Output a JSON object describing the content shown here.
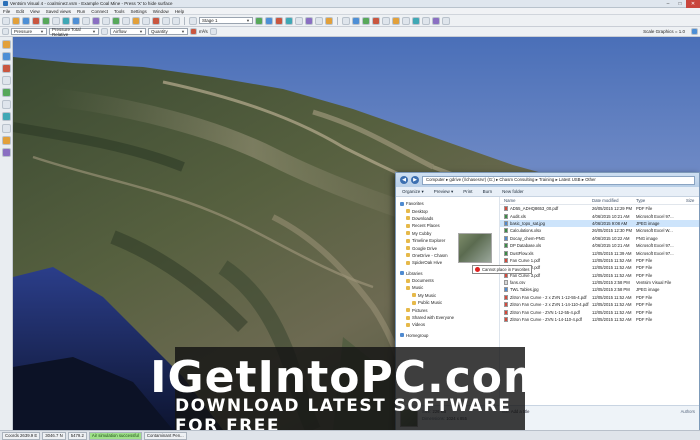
{
  "window": {
    "title": "Ventsim Visual 4 - coalmine2.vsm - Example Coal Mine - Press 'X' to hide surface",
    "buttons": {
      "minimize": "–",
      "maximize": "□",
      "close": "✕"
    }
  },
  "menu": [
    "File",
    "Edit",
    "View",
    "Saved views",
    "Run",
    "Connect",
    "Tools",
    "Settings",
    "Window",
    "Help"
  ],
  "toolbar": {
    "stage_combo": "Stage 1",
    "pressure_combo": "Pressure",
    "pressure_total_combo": "Pressure Total Relative",
    "airflow_combo": "Airflow",
    "quantity_combo": "Quantity",
    "units_label": "m³/s",
    "scale_text": "Scale Graphics = 1.0"
  },
  "explorer": {
    "path": "Computer ▸ gdrive (\\\\chasesrvr) (G:) ▸ Chasm Consulting ▸ Training ▸ Latest USB ▸ Other",
    "commands": [
      "Organize ▾",
      "Preview ▾",
      "Print",
      "Burn",
      "New folder"
    ],
    "nav": [
      {
        "label": "Favorites",
        "level": 0,
        "icon": "star-icon"
      },
      {
        "label": "Desktop",
        "level": 1,
        "icon": "folder-icon"
      },
      {
        "label": "Downloads",
        "level": 1,
        "icon": "folder-icon"
      },
      {
        "label": "Recent Places",
        "level": 1,
        "icon": "folder-icon"
      },
      {
        "label": "My Cubby",
        "level": 1,
        "icon": "folder-icon"
      },
      {
        "label": "Timeline Explorer",
        "level": 1,
        "icon": "folder-icon"
      },
      {
        "label": "Google Drive",
        "level": 1,
        "icon": "folder-icon"
      },
      {
        "label": "OneDrive - Chasm",
        "level": 1,
        "icon": "folder-icon"
      },
      {
        "label": "SpiderOak Hive",
        "level": 1,
        "icon": "folder-icon"
      },
      {
        "label": "Libraries",
        "level": 0,
        "icon": "library-icon",
        "gap": true
      },
      {
        "label": "Documents",
        "level": 1,
        "icon": "folder-icon"
      },
      {
        "label": "Music",
        "level": 1,
        "icon": "folder-icon"
      },
      {
        "label": "My Music",
        "level": 2,
        "icon": "folder-icon"
      },
      {
        "label": "Public Music",
        "level": 2,
        "icon": "folder-icon"
      },
      {
        "label": "Pictures",
        "level": 1,
        "icon": "folder-icon"
      },
      {
        "label": "Shared with Everyone",
        "level": 1,
        "icon": "folder-icon"
      },
      {
        "label": "Videos",
        "level": 1,
        "icon": "folder-icon"
      },
      {
        "label": "Homegroup",
        "level": 0,
        "icon": "homegroup-icon",
        "gap": true
      }
    ],
    "columns": [
      "Name",
      "Date modified",
      "Type",
      "Size"
    ],
    "files": [
      {
        "name": "AD55_ADHQ8653_00.pdf",
        "date": "26/05/2015 12:29 PM",
        "type": "PDF File",
        "size": "",
        "icon": "pdf"
      },
      {
        "name": "Audit.xls",
        "date": "4/06/2015 10:21 AM",
        "type": "Microsoft Excel 97...",
        "size": "",
        "icon": "xls"
      },
      {
        "name": "basic_topo_sat.jpg",
        "date": "4/06/2015 9:08 AM",
        "type": "JPEG image",
        "size": "",
        "icon": "img",
        "selected": true
      },
      {
        "name": "Calculations.xlsx",
        "date": "26/05/2015 12:30 PM",
        "type": "Microsoft Excel W...",
        "size": "",
        "icon": "xls"
      },
      {
        "name": "Docay_chem-PNG",
        "date": "4/06/2015 10:22 AM",
        "type": "PNG image",
        "size": "",
        "icon": "img"
      },
      {
        "name": "DP Database.xls",
        "date": "4/06/2015 10:21 AM",
        "type": "Microsoft Excel 97...",
        "size": "",
        "icon": "xls"
      },
      {
        "name": "DustFlow.xls",
        "date": "12/05/2015 11:39 AM",
        "type": "Microsoft Excel 97...",
        "size": "",
        "icon": "xls"
      },
      {
        "name": "Fan Curve 1.pdf",
        "date": "12/05/2015 11:52 AM",
        "type": "PDF File",
        "size": "",
        "icon": "pdf"
      },
      {
        "name": "Fan Curve 2.pdf",
        "date": "12/05/2015 11:52 AM",
        "type": "PDF File",
        "size": "",
        "icon": "pdf"
      },
      {
        "name": "Fan Curve 3.pdf",
        "date": "12/05/2015 11:52 AM",
        "type": "PDF File",
        "size": "",
        "icon": "pdf"
      },
      {
        "name": "fans.csv",
        "date": "12/05/2015 2:58 PM",
        "type": "Ventsim Visual File",
        "size": "",
        "icon": "doc"
      },
      {
        "name": "TWL Tables.jpg",
        "date": "12/05/2015 2:58 PM",
        "type": "JPEG image",
        "size": "",
        "icon": "img"
      },
      {
        "name": "Zitron Fan Curve - 2 x ZVN 1-12-55-4.pdf",
        "date": "12/05/2015 11:52 AM",
        "type": "PDF File",
        "size": "",
        "icon": "pdf"
      },
      {
        "name": "Zitron Fan Curve - 2 x ZVN 1-14-110-4.pdf",
        "date": "12/05/2015 11:52 AM",
        "type": "PDF File",
        "size": "",
        "icon": "pdf"
      },
      {
        "name": "Zitron Fan Curve - ZVN 1-12-55-4.pdf",
        "date": "12/05/2015 11:52 AM",
        "type": "PDF File",
        "size": "",
        "icon": "pdf"
      },
      {
        "name": "Zitron Fan Curve - ZVN 1-14-110-4.pdf",
        "date": "12/05/2015 11:52 AM",
        "type": "PDF File",
        "size": "",
        "icon": "pdf"
      }
    ],
    "drag_tooltip": "Cannot place in Favorites",
    "details": {
      "size_label": "Size:",
      "size_value": "226 KB",
      "dims_label": "Dimensions:",
      "dims_value": "1024 x 855",
      "title_label": "Title:",
      "title_value": "Add a title",
      "authors_label": "Authors"
    }
  },
  "status": {
    "coords": "Coords 2639.9 E",
    "coords2": "3046.7 N",
    "coords3": "5479.2",
    "message": "Air simulation successful",
    "extra": "Contaminant Pen..."
  },
  "watermark": {
    "logo": "IGetIntoPC.com",
    "tagline": "Download Latest Software for Free"
  },
  "colors": {
    "selection": "#cde4fb",
    "status_ok": "#9fe08a",
    "close_button": "#c9463d"
  }
}
